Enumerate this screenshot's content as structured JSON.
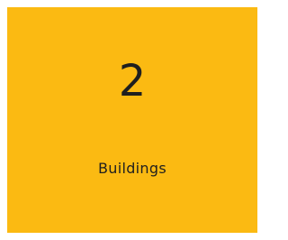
{
  "stat": {
    "value": "2",
    "label": "Buildings",
    "background_color": "#fbba12",
    "text_color": "#1f1f1f"
  }
}
